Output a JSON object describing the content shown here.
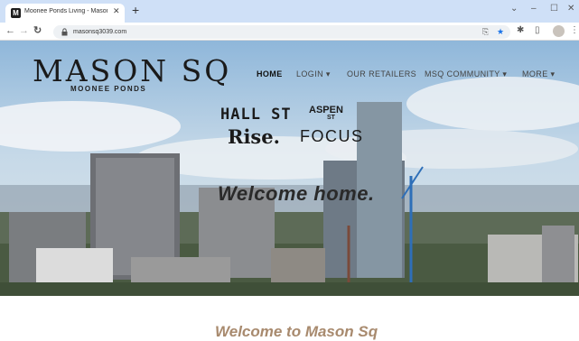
{
  "browser": {
    "tab_icon_letter": "M",
    "tab_title": "Moonee Ponds Living - Mason Sq",
    "tab_close": "✕",
    "new_tab": "+",
    "url": "masonsq3039.com",
    "window_controls": {
      "dropdown": "⌄",
      "minimize": "–",
      "maximize": "☐",
      "close": "✕"
    },
    "nav_buttons": {
      "back": "←",
      "forward": "→",
      "reload": "↻"
    },
    "omnibox_icons": {
      "share": "⎘",
      "star": "★"
    },
    "toolbar_icons": {
      "extensions": "✱",
      "sidepanel": "▯",
      "menu": "⋮"
    }
  },
  "site": {
    "logo": {
      "main": "MASON SQ",
      "sub": "MOONEE PONDS"
    },
    "nav": [
      {
        "label": "HOME",
        "active": true
      },
      {
        "label": "LOGIN ▾",
        "active": false
      },
      {
        "label": "OUR RETAILERS",
        "active": false
      },
      {
        "label": "MSQ COMMUNITY ▾",
        "active": false
      },
      {
        "label": "MORE ▾",
        "active": false
      }
    ],
    "brands": {
      "hall_st": "HALL ST",
      "aspen": "ASPEN",
      "aspen_st": "ST",
      "rise": "Rise.",
      "focus": "FOCUS"
    },
    "hero_text": "Welcome home.",
    "section_title": "Welcome to Mason Sq"
  },
  "colors": {
    "accent_blue": "#1a73e8",
    "section_title": "#a88a6e",
    "tab_strip": "#cfe0f7"
  }
}
